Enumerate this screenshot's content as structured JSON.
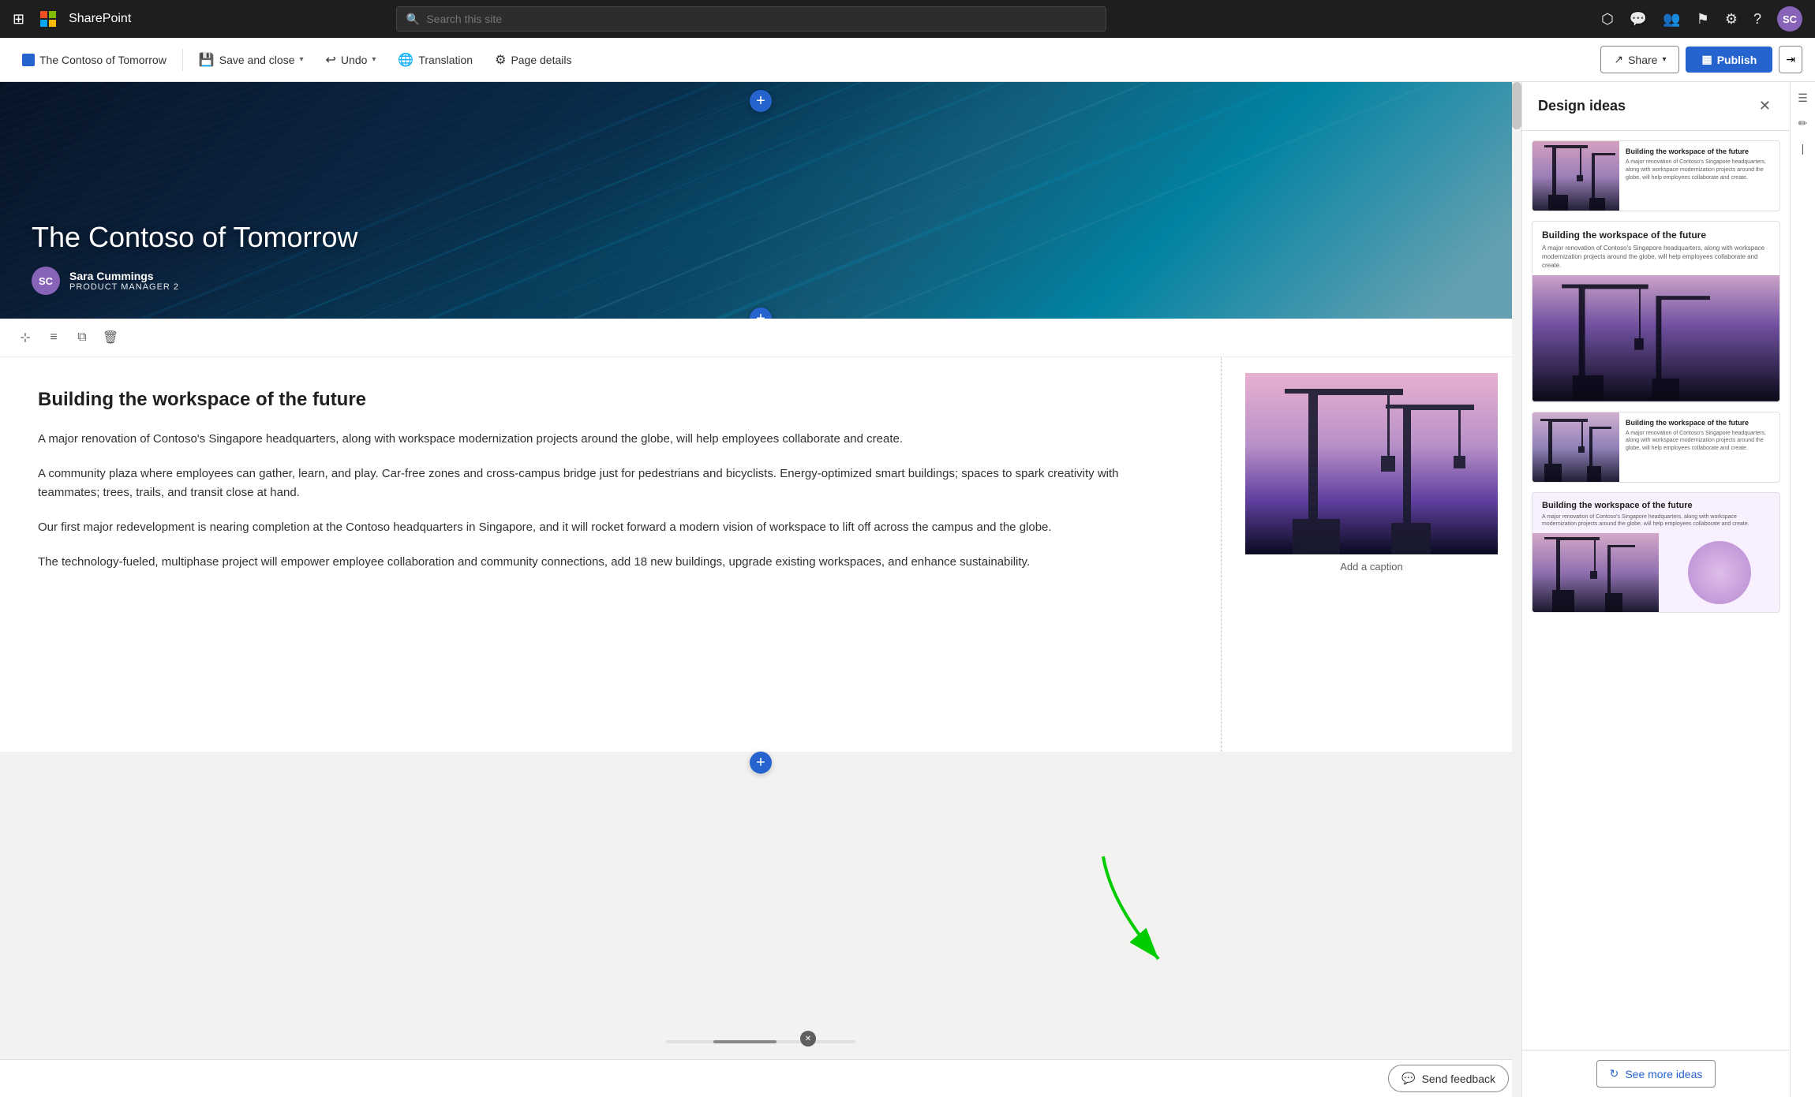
{
  "nav": {
    "brand": "SharePoint",
    "search_placeholder": "Search this site",
    "apps_label": "Apps",
    "avatar_initials": "SC"
  },
  "toolbar": {
    "page_title": "The Contoso of Tomorrow",
    "save_close_label": "Save and close",
    "undo_label": "Undo",
    "translation_label": "Translation",
    "page_details_label": "Page details",
    "share_label": "Share",
    "publish_label": "Publish"
  },
  "hero": {
    "title": "The Contoso of Tomorrow",
    "author_name": "Sara Cummings",
    "author_role": "PRODUCT MANAGER 2",
    "author_initials": "SC"
  },
  "content": {
    "section_title": "Building the workspace of the future",
    "paragraph1": "A major renovation of Contoso's Singapore headquarters, along with workspace modernization projects around the globe, will help employees collaborate and create.",
    "paragraph2": "A community plaza where employees can gather, learn, and play. Car-free zones and cross-campus bridge just for pedestrians and bicyclists. Energy-optimized smart buildings; spaces to spark creativity with teammates; trees, trails, and transit close at hand.",
    "paragraph3": "Our first major redevelopment is nearing completion at the Contoso headquarters in Singapore, and it will rocket forward a modern vision of workspace to lift off across the campus and the globe.",
    "paragraph4": "The technology-fueled, multiphase project will empower employee collaboration and community connections, add 18 new buildings, upgrade existing workspaces, and enhance sustainability.",
    "image_caption": "Add a caption"
  },
  "design_panel": {
    "title": "Design ideas",
    "close_label": "Close",
    "card1_title": "Building the workspace of the future",
    "card1_body": "A major renovation of Contoso's Singapore headquarters, along with workspace modernization projects around the globe, will help employees collaborate and create.",
    "card2_title": "Building the workspace of the future",
    "card2_body": "A major renovation of Contoso's Singapore headquarters, along with workspace modernization projects around the globe, will help employees collaborate and create.",
    "card3_title": "Building the workspace of the future",
    "card3_body": "A major renovation of Contoso's Singapore headquarters, along with workspace modernization projects around the globe, will help employees collaborate and create.",
    "card4_title": "Building the workspace of the future",
    "card4_body": "A major renovation of Contoso's Singapore headquarters, along with workspace modernization projects around the globe, will help employees collaborate and create.",
    "see_more_label": "See more ideas",
    "send_feedback_label": "Send feedback"
  }
}
